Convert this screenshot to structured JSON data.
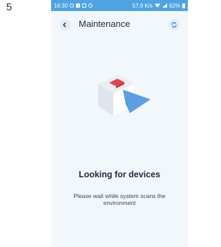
{
  "step": {
    "number": "5"
  },
  "status_bar": {
    "time": "16:30",
    "speed": "57,9 K/s",
    "battery": "62%"
  },
  "header": {
    "title": "Maintenance",
    "back_icon": "chevron-left-icon",
    "refresh_icon": "refresh-icon"
  },
  "main": {
    "illustration_icon": "device-scan-illustration",
    "heading": "Looking for devices",
    "subtext": "Please wait while system scans the environment"
  },
  "colors": {
    "status_bar": "#4fa3e2",
    "background": "#f2f7fb",
    "accent": "#3d86d6",
    "highlight": "#e0474c"
  }
}
